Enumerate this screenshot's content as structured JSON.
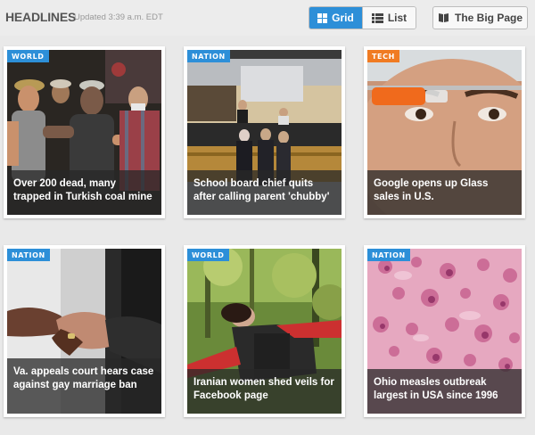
{
  "header": {
    "title": "HEADLINES",
    "updated": "Updated 3:39 a.m. EDT",
    "grid_label": "Grid",
    "list_label": "List",
    "bigpage_label": "The Big Page",
    "accent": "#2d8fd8"
  },
  "cards": [
    {
      "tag": "WORLD",
      "tag_color": "#2d8fd8",
      "caption": "Over 200 dead, many trapped in Turkish coal mine",
      "image": "coal-mine-rescue-photo"
    },
    {
      "tag": "NATION",
      "tag_color": "#2d8fd8",
      "caption": "School board chief quits after calling parent 'chubby'",
      "image": "school-board-meeting-photo"
    },
    {
      "tag": "TECH",
      "tag_color": "#f07b22",
      "caption": "Google opens up Glass sales in U.S.",
      "image": "google-glass-wearer-photo"
    },
    {
      "tag": "NATION",
      "tag_color": "#2d8fd8",
      "caption": "Va. appeals court hears case against gay marriage ban",
      "image": "holding-hands-photo"
    },
    {
      "tag": "WORLD",
      "tag_color": "#2d8fd8",
      "caption": "Iranian women shed veils for Facebook page",
      "image": "woman-in-forest-photo"
    },
    {
      "tag": "NATION",
      "tag_color": "#2d8fd8",
      "caption": "Ohio measles outbreak largest in USA since 1996",
      "image": "measles-cells-micrograph"
    }
  ]
}
